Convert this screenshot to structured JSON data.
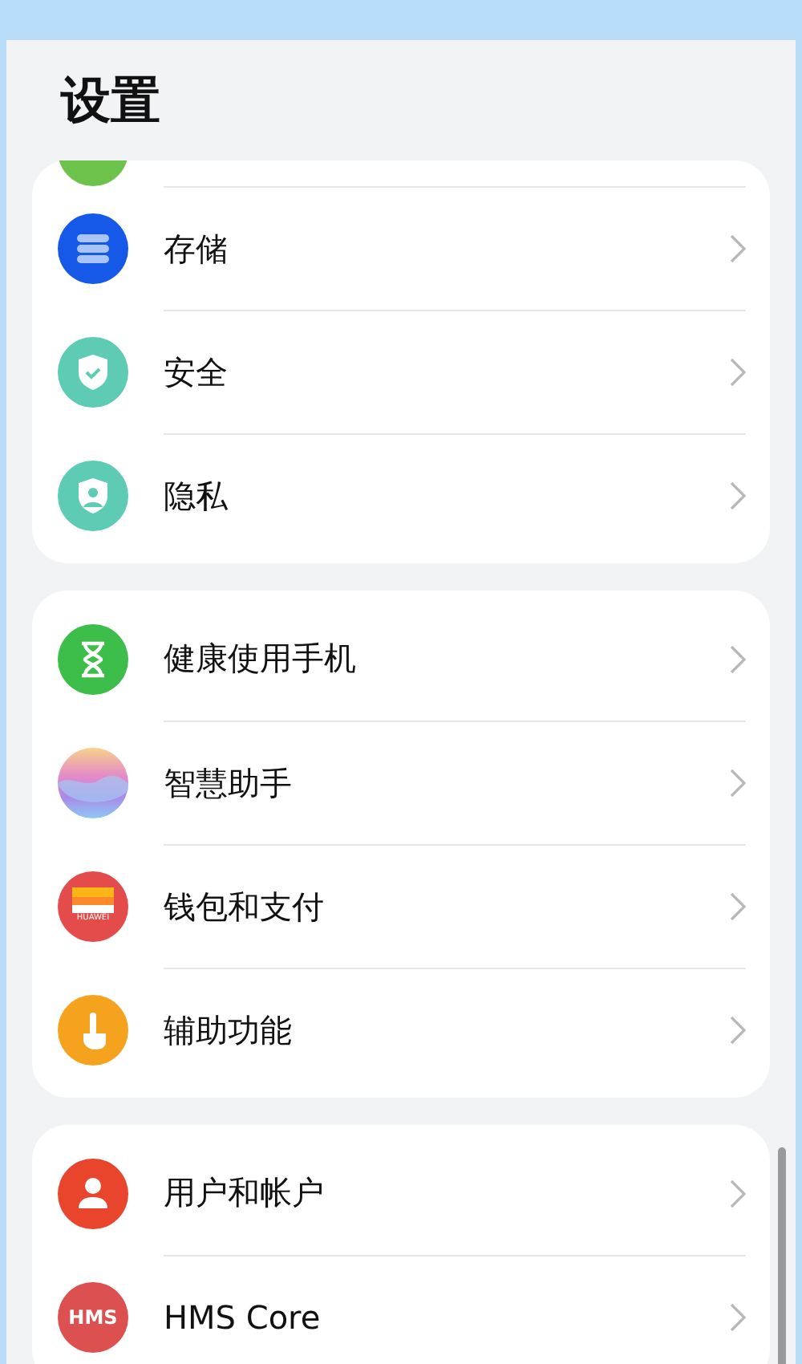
{
  "title": "设置",
  "groups": [
    {
      "items": [
        {
          "kind": "clipped"
        },
        {
          "kind": "storage",
          "label": "存储"
        },
        {
          "kind": "security",
          "label": "安全"
        },
        {
          "kind": "privacy",
          "label": "隐私"
        }
      ]
    },
    {
      "items": [
        {
          "kind": "hourglass",
          "label": "健康使用手机"
        },
        {
          "kind": "assistant",
          "label": "智慧助手"
        },
        {
          "kind": "wallet",
          "label": "钱包和支付",
          "icon_text": "HUAWEI"
        },
        {
          "kind": "accessibility",
          "label": "辅助功能"
        }
      ]
    },
    {
      "items": [
        {
          "kind": "user",
          "label": "用户和帐户"
        },
        {
          "kind": "hms",
          "label": "HMS Core",
          "icon_text": "HMS"
        }
      ]
    }
  ]
}
